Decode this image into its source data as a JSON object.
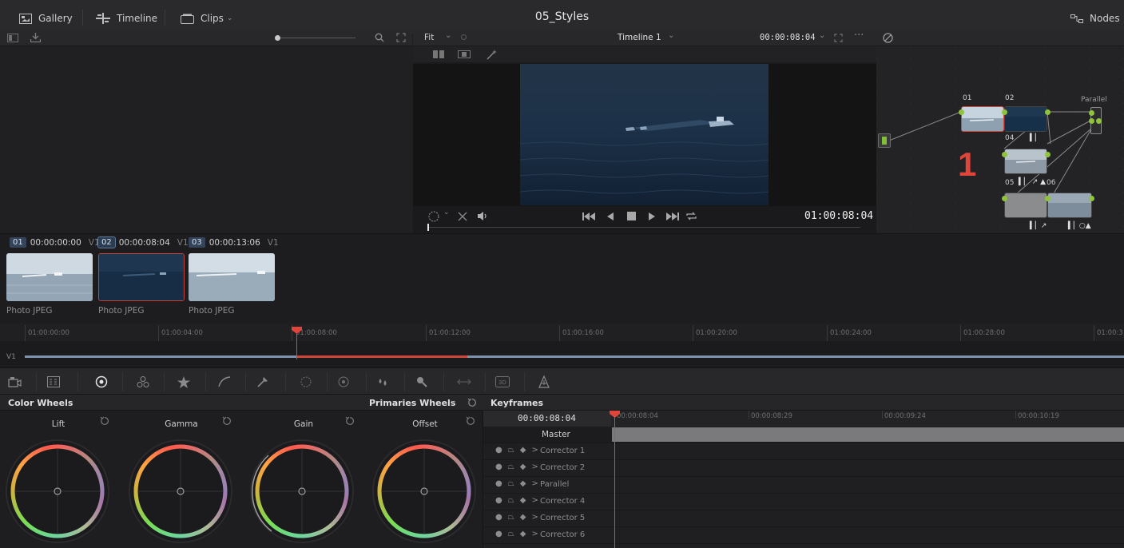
{
  "topbar": {
    "gallery": "Gallery",
    "timeline": "Timeline",
    "clips": "Clips",
    "title": "05_Styles",
    "nodes": "Nodes"
  },
  "viewer": {
    "fit": "Fit",
    "timeline_name": "Timeline 1",
    "timecode_top": "00:00:08:04",
    "timecode": "01:00:08:04"
  },
  "clips": [
    {
      "num": "01",
      "tc": "00:00:00:00",
      "track": "V1",
      "type": "Photo JPEG"
    },
    {
      "num": "02",
      "tc": "00:00:08:04",
      "track": "V1",
      "type": "Photo JPEG"
    },
    {
      "num": "03",
      "tc": "00:00:13:06",
      "track": "V1",
      "type": "Photo JPEG"
    }
  ],
  "ruler": [
    "01:00:00:00",
    "01:00:04:00",
    "01:00:08:00",
    "01:00:12:00",
    "01:00:16:00",
    "01:00:20:00",
    "01:00:24:00",
    "01:00:28:00",
    "01:00:3"
  ],
  "track_label": "V1",
  "nodes": {
    "labels": [
      "01",
      "02",
      "04",
      "05",
      "06"
    ],
    "parallel": "Parallel",
    "annotation": "1"
  },
  "color_wheels": {
    "title": "Color Wheels",
    "mode": "Primaries Wheels",
    "wheels": [
      "Lift",
      "Gamma",
      "Gain",
      "Offset"
    ]
  },
  "keyframes": {
    "title": "Keyframes",
    "timecode": "00:00:08:04",
    "ticks": [
      "00:00:08:04",
      "00:00:08:29",
      "00:00:09:24",
      "00:00:10:19"
    ],
    "master": "Master",
    "rows": [
      "Corrector 1",
      "Corrector 2",
      "Parallel",
      "Corrector 4",
      "Corrector 5",
      "Corrector 6"
    ]
  },
  "colors": {
    "accent_red": "#e0453b",
    "node_green": "#8fc33a",
    "playhead": "#e0453b"
  }
}
